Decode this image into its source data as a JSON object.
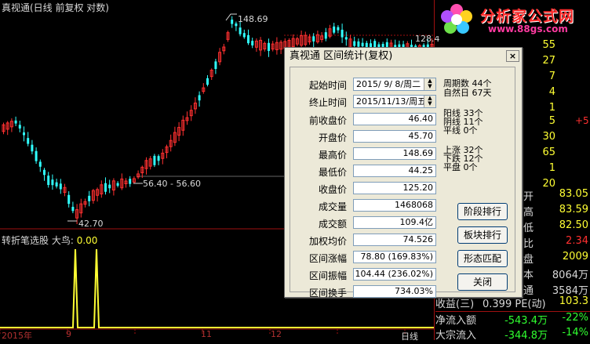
{
  "chart": {
    "title": "真视通(日线 前复权 对数)",
    "high_label": "148.69",
    "range_label": "56.40 - 56.60",
    "low_label": "42.70",
    "axis_label_128": "128.4",
    "indicator_title": "转折笔选股",
    "indicator_series": "大鸟:",
    "indicator_value": "0.00",
    "x_labels": [
      "2015年",
      "9",
      "11",
      "12"
    ]
  },
  "logo": {
    "text": "分析家公式网",
    "url": "www.88gs.com"
  },
  "right_panel": {
    "top_numbers": [
      "55",
      "27",
      "7",
      "4",
      "1"
    ],
    "mid_numbers": [
      {
        "v": "5",
        "extra": "+5"
      },
      {
        "v": "30",
        "extra": ""
      },
      {
        "v": "65",
        "extra": ""
      },
      {
        "v": "1",
        "extra": ""
      },
      {
        "v": "20",
        "extra": ""
      }
    ],
    "quotes": [
      {
        "label": "开",
        "value": "83.05",
        "color": "#ffff33"
      },
      {
        "label": "高",
        "value": "83.59",
        "color": "#ffff33"
      },
      {
        "label": "低",
        "value": "82.50",
        "color": "#ffff33"
      },
      {
        "label": "比",
        "value": "2.34",
        "color": "#ff3030"
      },
      {
        "label": "盘",
        "value": "2009",
        "color": "#ffff33"
      },
      {
        "label": "本",
        "value": "8064万",
        "color": "#d8d8d8"
      },
      {
        "label": "通",
        "value": "3584万",
        "color": "#d8d8d8"
      }
    ],
    "pe_row": {
      "label": "收益(三)",
      "mid": "0.399 PE(动)",
      "value": "103.3"
    },
    "flow_rows": [
      {
        "label": "净流入额",
        "value": "-543.4万",
        "pct": "-22%"
      },
      {
        "label": "大宗流入",
        "value": "-344.8万",
        "pct": "-14%"
      }
    ],
    "bottom_label": "日线"
  },
  "dialog": {
    "title": "真视通 区间统计(复权)",
    "close_glyph": "×",
    "start_label": "起始时间",
    "start_value": "2015/ 9/ 8/周二",
    "end_label": "终止时间",
    "end_value": "2015/11/13/周五",
    "fields": [
      {
        "label": "前收盘价",
        "value": "46.40"
      },
      {
        "label": "开盘价",
        "value": "45.70"
      },
      {
        "label": "最高价",
        "value": "148.69"
      },
      {
        "label": "最低价",
        "value": "44.25"
      },
      {
        "label": "收盘价",
        "value": "125.20"
      },
      {
        "label": "成交量",
        "value": "1468068"
      },
      {
        "label": "成交额",
        "value": "109.4亿"
      },
      {
        "label": "加权均价",
        "value": "74.526"
      },
      {
        "label": "区间涨幅",
        "value": "78.80 (169.83%)"
      },
      {
        "label": "区间振幅",
        "value": "104.44 (236.02%)"
      },
      {
        "label": "区间换手",
        "value": "734.03%"
      }
    ],
    "stats": {
      "period_days": "周期数 44个",
      "natural_days": "自然日 67天",
      "yang": "阳线 33个",
      "yin": "阴线 11个",
      "flat": "平线 0个",
      "up": "上涨 32个",
      "down": "下跌 12个",
      "level": "平盘 0个"
    },
    "buttons": [
      "阶段排行",
      "板块排行",
      "形态匹配",
      "关闭"
    ]
  }
}
